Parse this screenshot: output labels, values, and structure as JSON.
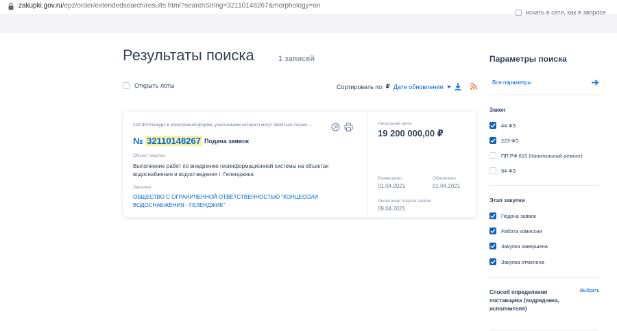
{
  "browser": {
    "url_host": "zakupki.gov.ru",
    "url_rest": "/epz/order/extendedsearch/results.html?searchString=32110148267&morphology=on"
  },
  "top_strip": {
    "truncated_text": "искать в сети, как в запросе"
  },
  "results": {
    "title": "Результаты поиска",
    "count": "1 записей",
    "open_lots": "Открыть лоты",
    "sort_label": "Сортировать по:",
    "sort_currency": "₽",
    "sort_field": "Дате обновления"
  },
  "card": {
    "law_text": "223-ФЗ Конкурс в электронной форме, участниками которого могут являться только ...",
    "number_prefix": "№",
    "number": "32110148267",
    "status": "Подача заявок",
    "object_label": "Объект закупки",
    "object_text": "Выполнение работ по внедрению геоинформационной системы на объектах водоснабжения и водоотведения г. Геленджика",
    "customer_label": "Заказчик",
    "customer_text": "ОБЩЕСТВО С ОГРАНИЧЕННОЙ ОТВЕТСТВЕННОСТЬЮ \"КОНЦЕССИИ ВОДОСНАБЖЕНИЯ - ГЕЛЕНДЖИК\"",
    "price_label": "Начальная цена",
    "price": "19 200 000,00 ₽",
    "placed_label": "Размещено",
    "placed_date": "01.04.2021",
    "updated_label": "Обновлено",
    "updated_date": "01.04.2021",
    "deadline_label": "Окончание подачи заявок",
    "deadline_date": "09.04.2021"
  },
  "sidebar": {
    "title": "Параметры поиска",
    "all_params": "Все параметры",
    "law_section": "Закон",
    "laws": [
      {
        "label": "44-ФЗ",
        "checked": true
      },
      {
        "label": "223-ФЗ",
        "checked": true
      },
      {
        "label": "ПП РФ 615 (Капитальный ремонт)",
        "checked": false
      },
      {
        "label": "94-ФЗ",
        "checked": false
      }
    ],
    "stage_section": "Этап закупки",
    "stages": [
      {
        "label": "Подача заявок",
        "checked": true
      },
      {
        "label": "Работа комиссии",
        "checked": true
      },
      {
        "label": "Закупка завершена",
        "checked": true
      },
      {
        "label": "Закупка отменена",
        "checked": true
      }
    ],
    "method_section": "Способ определения поставщика (подрядчика, исполнителя)",
    "method_choose": "Выбрать"
  },
  "colors": {
    "accent": "#0065dd",
    "text": "#334059",
    "checkbox": "#0d5fbf",
    "rss": "#f26522"
  }
}
